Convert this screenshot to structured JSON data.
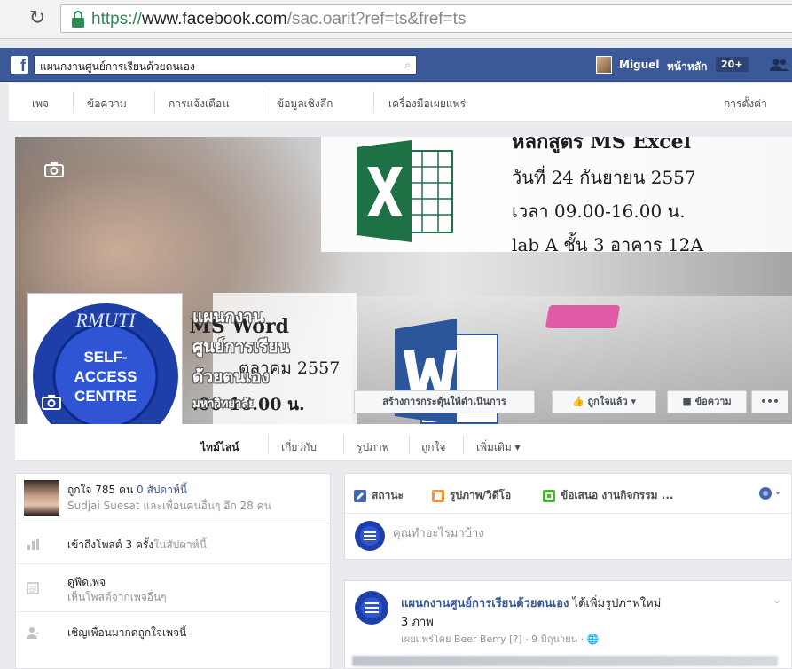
{
  "browser": {
    "url_scheme": "https://",
    "url_host": "www.facebook.com",
    "url_path": "/sac.oarit?ref=ts&fref=ts"
  },
  "topbar": {
    "logo": "f",
    "search_value": "แผนกงานศูนย์การเรียนด้วยตนเอง",
    "user_name": "Miguel",
    "home_label": "หน้าหลัก",
    "home_count": "20+"
  },
  "admin_nav": {
    "items": [
      "เพจ",
      "ข้อความ",
      "การแจ้งเตือน",
      "ข้อมูลเชิงลึก",
      "เครื่องมือเผยแพร่"
    ],
    "settings": "การตั้งค่า"
  },
  "cover": {
    "top_line": "หลักสูตร MS Excel",
    "date_line": "วันที่ 24 กันยายน 2557",
    "time_line": "เวลา 09.00-16.00 น.",
    "place_line": "lab A ชั้น 3 อาคาร 12A",
    "word_line1": "ร MS Word",
    "word_line2": "ตุลาคม 2557",
    "word_line3": ".00-16.00 น.",
    "overlay_line1": "แผนกงาน",
    "overlay_line2": "ศูนย์การเรียน",
    "overlay_line3": "ด้วยตนเอง",
    "overlay_line4": "มหาวิทยาลัย"
  },
  "profile_logo": {
    "top_text": "RMUTI",
    "line1": "SELF-",
    "line2": "ACCESS",
    "line3": "CENTRE"
  },
  "cover_buttons": {
    "cta": "สร้างการกระตุ้นให้ดำเนินการ",
    "liked": "ถูกใจแล้ว ▾",
    "message": "ข้อความ",
    "more": "•••"
  },
  "tabs": {
    "timeline": "ไทม์ไลน์",
    "about": "เกี่ยวกับ",
    "photos": "รูปภาพ",
    "likes": "ถูกใจ",
    "more": "เพิ่มเติม ▾"
  },
  "left": {
    "likes_count": "ถูกใจ 785 คน",
    "likes_week": "0 สัปดาห์นี้",
    "likes_friends": "Sudjai Suesat และเพื่อนคนอื่นๆ อีก 28 คน",
    "reach_text": "เข้าถึงโพสต์ 3 ครั้ง",
    "reach_week": "ในสัปดาห์นี้",
    "feed_title": "ดูฟีดเพจ",
    "feed_sub": "เห็นโพสต์จากเพจอื่นๆ",
    "invite": "เชิญเพื่อนมากดถูกใจเพจนี้"
  },
  "composer": {
    "status": "สถานะ",
    "photo_video": "รูปภาพ/วิดีโอ",
    "offer": "ข้อเสนอ งานกิจกรรม ...",
    "placeholder": "คุณทำอะไรมาบ้าง"
  },
  "post": {
    "author": "แผนกงานศูนย์การเรียนด้วยตนเอง",
    "action": " ได้เพิ่มรูปภาพใหม่",
    "count": "3 ภาพ",
    "meta": "เผยแพร่โดย Beer Berry [?] · 9 มิถุนายน · 🌐",
    "chevron": "⌄"
  },
  "colors": {
    "facebook_blue": "#3b5998",
    "link_blue": "#365899",
    "excel_green": "#1e7145",
    "word_blue": "#2b579a",
    "logo_blue": "#1f3fa8"
  }
}
